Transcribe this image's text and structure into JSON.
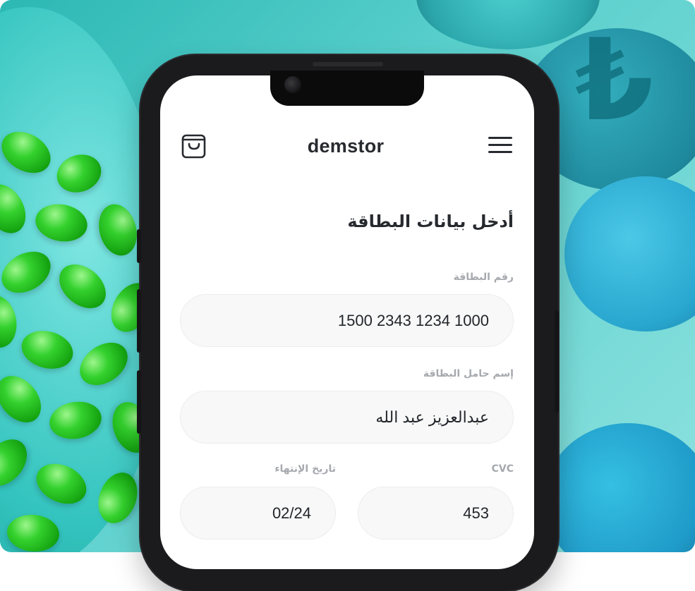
{
  "header": {
    "brand": "demstor",
    "cart_icon": "shopping-bag-icon",
    "menu_icon": "hamburger-menu-icon"
  },
  "form": {
    "title": "أدخل بيانات البطاقة",
    "card_number": {
      "label": "رقم البطاقة",
      "value": "1500 2343 1234 1000"
    },
    "card_holder": {
      "label": "إسم حامل البطاقة",
      "value": "عبدالعزيز عبد الله"
    },
    "cvc": {
      "label": "CVC",
      "value": "453"
    },
    "expiry": {
      "label": "تاريخ الإنتهاء",
      "value": "02/24"
    }
  },
  "colors": {
    "text_dark": "#26292e",
    "label_gray": "#a6a9ae",
    "field_bg": "#f8f8f8",
    "phone_frame": "#1b1b1d",
    "background_teal": "#59cfcc",
    "jelly_bean_green": "#34d12e"
  }
}
